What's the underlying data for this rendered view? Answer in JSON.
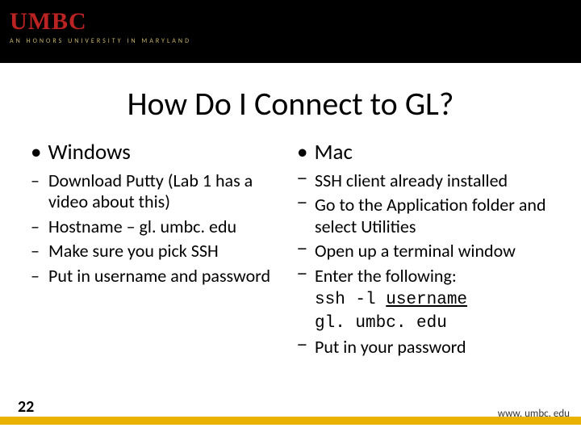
{
  "header": {
    "logo": "UMBC",
    "tagline": "AN  HONORS  UNIVERSITY  IN  MARYLAND"
  },
  "title": "How Do I Connect to GL?",
  "left": {
    "heading": "Windows",
    "items": [
      "Download Putty (Lab 1 has a video about this)",
      "Hostname – gl. umbc. edu",
      "Make sure you pick SSH",
      "Put in username and password"
    ]
  },
  "right": {
    "heading": "Mac",
    "items": [
      "SSH client already installed",
      "Go to the Application folder and select Utilities",
      "Open up a terminal window",
      "Enter the following:"
    ],
    "code_line1_pre": "ssh -l ",
    "code_line1_u": "username",
    "code_line2": "gl. umbc. edu",
    "last": "Put in your password"
  },
  "page": "22",
  "footer_url": "www. umbc. edu"
}
